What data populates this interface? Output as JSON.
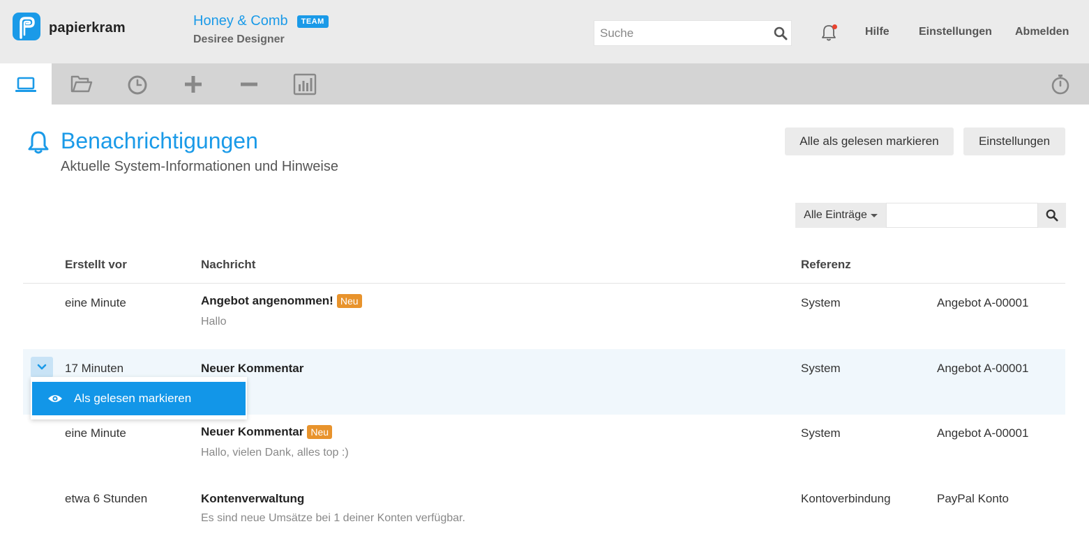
{
  "header": {
    "logo_text": "papierkram",
    "company_name": "Honey & Comb",
    "team_badge": "TEAM",
    "user_name": "Desiree Designer",
    "search_placeholder": "Suche",
    "links": [
      "Hilfe",
      "Einstellungen",
      "Abmelden"
    ]
  },
  "toolbar": {
    "tools": [
      "laptop-icon",
      "folder-icon",
      "clock-icon",
      "plus-icon",
      "minus-icon",
      "chart-icon"
    ],
    "right_tool": "stopwatch-icon"
  },
  "page": {
    "title": "Benachrichtigungen",
    "subtitle": "Aktuelle System-Informationen und Hinweise",
    "btn_mark_all": "Alle als gelesen markieren",
    "btn_settings": "Einstellungen",
    "filter_label": "Alle Einträge"
  },
  "table": {
    "columns": [
      "Erstellt vor",
      "Nachricht",
      "Referenz"
    ],
    "rows": [
      {
        "created": "eine Minute",
        "title": "Angebot angenommen!",
        "badge": "Neu",
        "body": "Hallo",
        "ref_type": "System",
        "ref_name": "Angebot A-00001"
      },
      {
        "created": "17 Minuten",
        "title": "Neuer Kommentar",
        "badge": "",
        "body": "",
        "ref_type": "System",
        "ref_name": "Angebot A-00001"
      },
      {
        "created": "eine Minute",
        "title": "Neuer Kommentar",
        "badge": "Neu",
        "body": "Hallo, vielen Dank, alles top :)",
        "ref_type": "System",
        "ref_name": "Angebot A-00001"
      },
      {
        "created": "etwa 6 Stunden",
        "title": "Kontenverwaltung",
        "badge": "",
        "body": "Es sind neue Umsätze bei 1 deiner Konten verfügbar.",
        "ref_type": "Kontoverbindung",
        "ref_name": "PayPal Konto"
      }
    ]
  },
  "dropdown": {
    "item_label": "Als gelesen markieren",
    "item_icon": "eye-icon"
  },
  "colors": {
    "accent": "#1a9ae8",
    "badge_new": "#e8932c",
    "notification_dot": "#e8432f"
  }
}
